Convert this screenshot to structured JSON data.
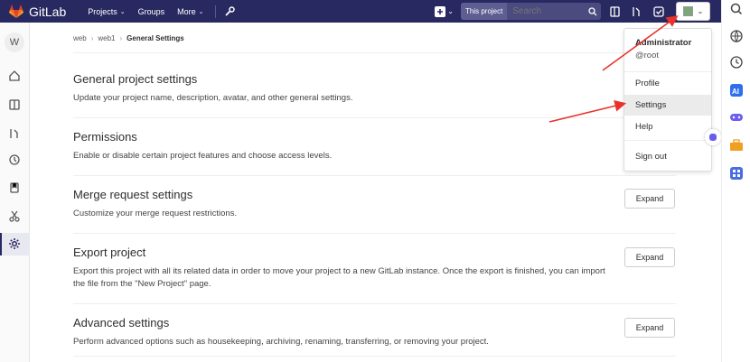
{
  "navbar": {
    "brand": "GitLab",
    "projects": "Projects",
    "groups": "Groups",
    "more": "More",
    "search_scope": "This project",
    "search_placeholder": "Search"
  },
  "sidebar": {
    "project_initial": "W"
  },
  "breadcrumb": {
    "items": [
      "web",
      "web1",
      "General Settings"
    ]
  },
  "sections": [
    {
      "title": "General project settings",
      "desc": "Update your project name, description, avatar, and other general settings."
    },
    {
      "title": "Permissions",
      "desc": "Enable or disable certain project features and choose access levels."
    },
    {
      "title": "Merge request settings",
      "desc": "Customize your merge request restrictions.",
      "button": "Expand"
    },
    {
      "title": "Export project",
      "desc": "Export this project with all its related data in order to move your project to a new GitLab instance. Once the export is finished, you can import the file from the \"New Project\" page.",
      "button": "Expand"
    },
    {
      "title": "Advanced settings",
      "desc": "Perform advanced options such as housekeeping, archiving, renaming, transferring, or removing your project.",
      "button": "Expand"
    }
  ],
  "user_menu": {
    "name": "Administrator",
    "handle": "@root",
    "items": [
      "Profile",
      "Settings",
      "Help",
      "Sign out"
    ]
  },
  "colors": {
    "navbar": "#292961",
    "annotation_arrow": "#e8332a"
  }
}
